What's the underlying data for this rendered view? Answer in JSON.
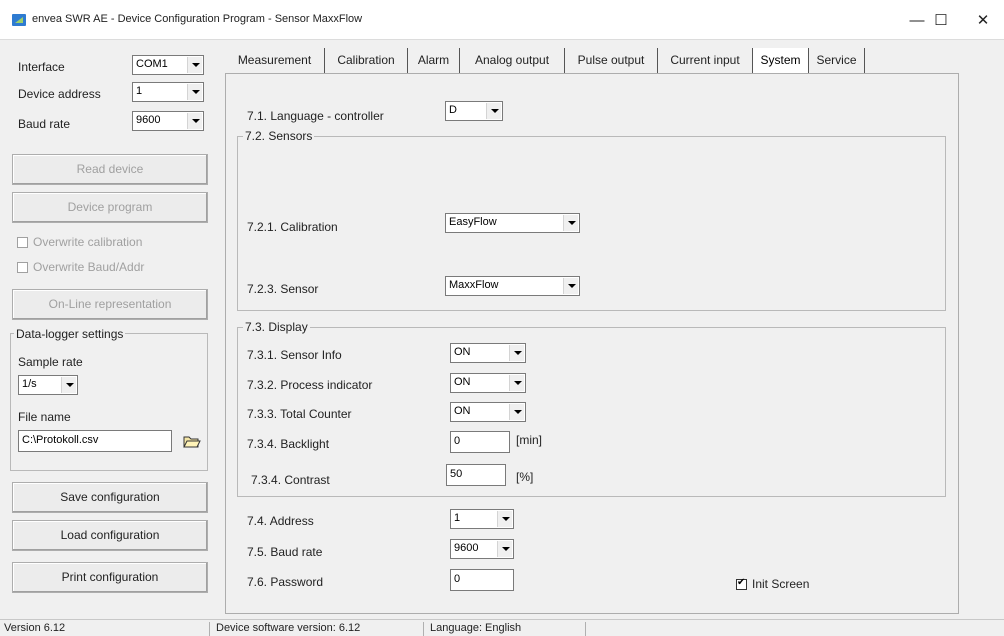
{
  "window": {
    "title": "envea SWR AE - Device Configuration Program - Sensor MaxxFlow",
    "minimize": "—",
    "maximize": "☐",
    "close": "✕"
  },
  "left": {
    "interface_label": "Interface",
    "interface_value": "COM1",
    "address_label": "Device address",
    "address_value": "1",
    "baud_label": "Baud rate",
    "baud_value": "9600",
    "read_device": "Read device",
    "device_program": "Device program",
    "overwrite_calibration": "Overwrite calibration",
    "overwrite_baud": "Overwrite Baud/Addr",
    "online_representation": "On-Line representation",
    "datalogger": {
      "legend": "Data-logger settings",
      "sample_rate_label": "Sample rate",
      "sample_rate_value": "1/s",
      "file_name_label": "File name",
      "file_name_value": "C:\\Protokoll.csv"
    },
    "save_configuration": "Save configuration",
    "load_configuration": "Load configuration",
    "print_configuration": "Print configuration"
  },
  "tabs": [
    {
      "label": "Measurement"
    },
    {
      "label": "Calibration"
    },
    {
      "label": "Alarm"
    },
    {
      "label": "Analog output"
    },
    {
      "label": "Pulse output"
    },
    {
      "label": "Current input"
    },
    {
      "label": "System"
    },
    {
      "label": "Service"
    }
  ],
  "system": {
    "language_label": "7.1. Language - controller",
    "language_value": "D",
    "sensors_legend": "7.2. Sensors",
    "calibration_label": "7.2.1. Calibration",
    "calibration_value": "EasyFlow",
    "sensor_label": "7.2.3. Sensor",
    "sensor_value": "MaxxFlow",
    "display_legend": "7.3. Display",
    "sensor_info_label": "7.3.1. Sensor Info",
    "sensor_info_value": "ON",
    "process_indicator_label": "7.3.2. Process indicator",
    "process_indicator_value": "ON",
    "total_counter_label": "7.3.3. Total Counter",
    "total_counter_value": "ON",
    "backlight_label": "7.3.4. Backlight",
    "backlight_value": "0",
    "backlight_unit": "[min]",
    "contrast_label": "7.3.4. Contrast",
    "contrast_value": "50",
    "contrast_unit": "[%]",
    "address_label": "7.4. Address",
    "address_value": "1",
    "baud_label": "7.5. Baud rate",
    "baud_value": "9600",
    "password_label": "7.6. Password",
    "password_value": "0",
    "init_screen_label": "Init Screen",
    "init_screen_checked": true
  },
  "status": {
    "version": "Version 6.12",
    "device_software": "Device software version: 6.12",
    "language": "Language: English"
  }
}
